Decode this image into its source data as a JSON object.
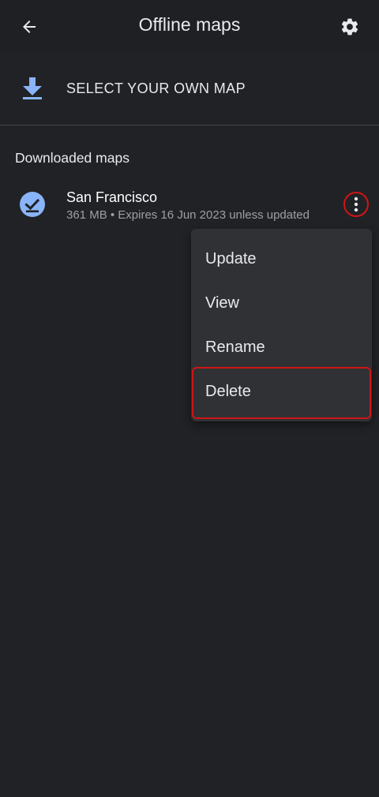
{
  "header": {
    "title": "Offline maps",
    "back_icon": "arrow-back-icon",
    "settings_icon": "gear-icon"
  },
  "select_map": {
    "label": "SELECT YOUR OWN MAP",
    "icon": "download-icon"
  },
  "section": {
    "title": "Downloaded maps"
  },
  "maps": [
    {
      "name": "San Francisco",
      "meta": "361 MB • Expires 16 Jun 2023 unless updated",
      "status_icon": "check-circle-icon",
      "overflow_icon": "more-vert-icon"
    }
  ],
  "menu": {
    "items": [
      {
        "label": "Update"
      },
      {
        "label": "View"
      },
      {
        "label": "Rename"
      },
      {
        "label": "Delete"
      }
    ],
    "highlighted": "Delete"
  },
  "colors": {
    "background": "#212226",
    "accent_blue": "#8ab4f8",
    "highlight_red": "#d11414",
    "menu_bg": "#303134"
  }
}
